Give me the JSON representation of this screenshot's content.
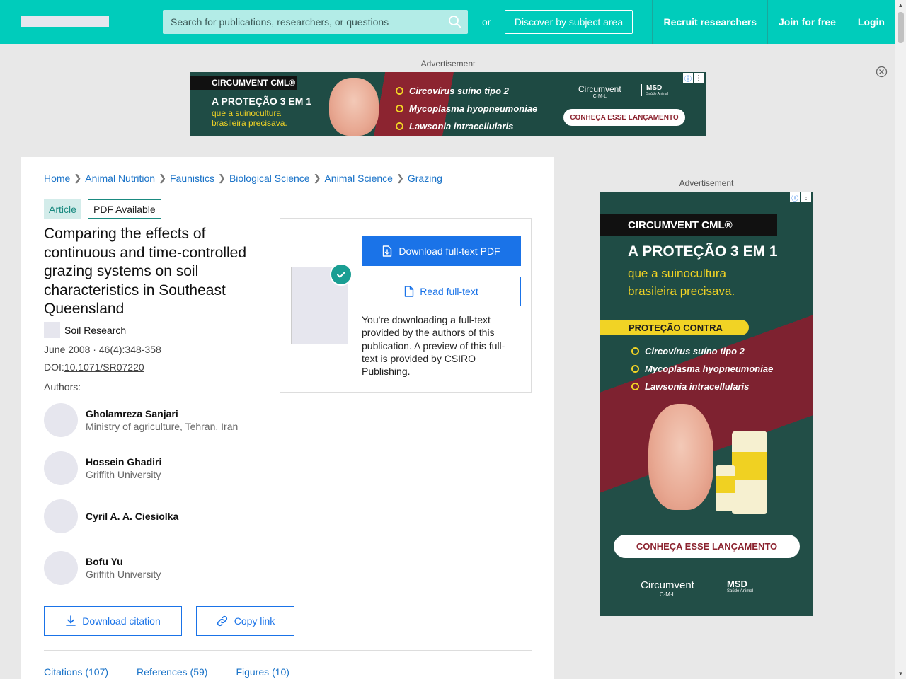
{
  "header": {
    "search_placeholder": "Search for publications, researchers, or questions",
    "or_label": "or",
    "discover_label": "Discover by subject area",
    "nav": [
      "Recruit researchers",
      "Join for free",
      "Login"
    ]
  },
  "ads": {
    "label": "Advertisement",
    "banner": {
      "brand": "CIRCUMVENT CML®",
      "headline": "A PROTEÇÃO 3 EM 1",
      "subline": "que a suinocultura brasileira precisava.",
      "items": [
        "Circovírus suíno tipo 2",
        "Mycoplasma hyopneumoniae",
        "Lawsonia intracellularis"
      ],
      "logo": "Circumvent",
      "logo_sub": "C·M·L",
      "msd": "MSD",
      "msd_sub": "Saúde Animal",
      "cta": "CONHEÇA ESSE LANÇAMENTO"
    },
    "side": {
      "brand": "CIRCUMVENT CML®",
      "headline": "A PROTEÇÃO 3 EM 1",
      "subline1": "que a suinocultura",
      "subline2": "brasileira precisava.",
      "protection": "PROTEÇÃO CONTRA",
      "items": [
        "Circovírus suíno tipo 2",
        "Mycoplasma hyopneumoniae",
        "Lawsonia intracellularis"
      ],
      "cta": "CONHEÇA ESSE LANÇAMENTO",
      "logo": "Circumvent",
      "logo_sub": "C·M·L",
      "msd": "MSD",
      "msd_sub": "Saúde Animal"
    }
  },
  "breadcrumb": [
    "Home",
    "Animal Nutrition",
    "Faunistics",
    "Biological Science",
    "Animal Science",
    "Grazing"
  ],
  "article": {
    "type_label": "Article",
    "pdf_label": "PDF Available",
    "title": "Comparing the effects of continuous and time-controlled grazing systems on soil characteristics in Southeast Queensland",
    "journal": "Soil Research",
    "pub_date": "June 2008 · 46(4):348-358",
    "doi_prefix": "DOI:",
    "doi": "10.1071/SR07220",
    "authors_label": "Authors:",
    "authors": [
      {
        "name": "Gholamreza Sanjari",
        "affiliation": "Ministry of agriculture, Tehran, Iran"
      },
      {
        "name": "Hossein Ghadiri",
        "affiliation": "Griffith University"
      },
      {
        "name": "Cyril A. A. Ciesiolka",
        "affiliation": ""
      },
      {
        "name": "Bofu Yu",
        "affiliation": "Griffith University"
      }
    ]
  },
  "download": {
    "pdf_button": "Download full-text PDF",
    "read_button": "Read full-text",
    "note": "You're downloading a full-text provided by the authors of this publication. A preview of this full-text is provided by CSIRO Publishing."
  },
  "actions": {
    "citation": "Download citation",
    "copy_link": "Copy link"
  },
  "tabs": [
    "Citations (107)",
    "References (59)",
    "Figures (10)"
  ]
}
